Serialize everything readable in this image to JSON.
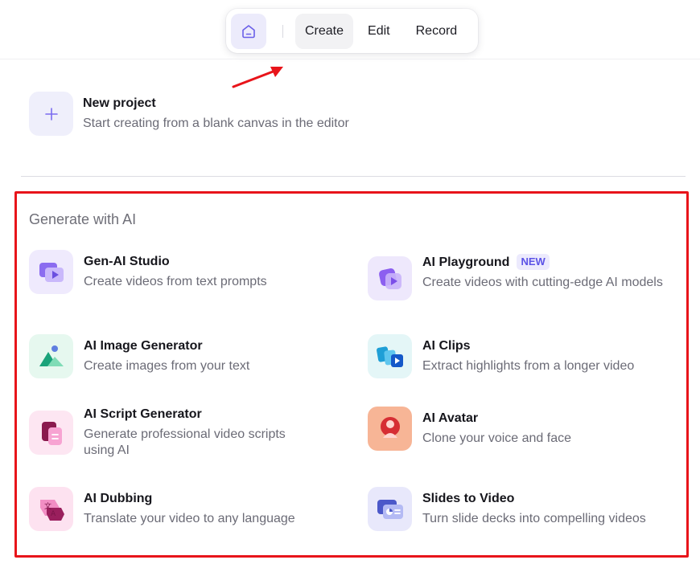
{
  "nav": {
    "tabs": [
      "Create",
      "Edit",
      "Record"
    ],
    "active_tab": "Create",
    "home_icon": "home-icon"
  },
  "new_project": {
    "title": "New project",
    "description": "Start creating from a blank canvas in the editor",
    "icon": "plus-icon"
  },
  "section": {
    "title": "Generate with AI"
  },
  "items": [
    {
      "title": "Gen-AI Studio",
      "description": "Create videos from text prompts",
      "icon": "video-play-icon"
    },
    {
      "title": "AI Playground",
      "description": "Create videos with cutting-edge AI models",
      "badge": "NEW",
      "icon": "playground-icon"
    },
    {
      "title": "AI Image Generator",
      "description": "Create images from your text",
      "icon": "image-generator-icon"
    },
    {
      "title": "AI Clips",
      "description": "Extract highlights from a longer video",
      "icon": "clips-icon"
    },
    {
      "title": "AI Script Generator",
      "description": "Generate professional video scripts using AI",
      "icon": "script-icon"
    },
    {
      "title": "AI Avatar",
      "description": "Clone your voice and face",
      "icon": "avatar-icon"
    },
    {
      "title": "AI Dubbing",
      "description": "Translate your video to any language",
      "icon": "translate-icon"
    },
    {
      "title": "Slides to Video",
      "description": "Turn slide decks into compelling videos",
      "icon": "slides-icon"
    }
  ],
  "colors": {
    "annotation_red": "#e8141a",
    "badge_text": "#5b52e6",
    "accent_purple": "#7b6cf0"
  }
}
